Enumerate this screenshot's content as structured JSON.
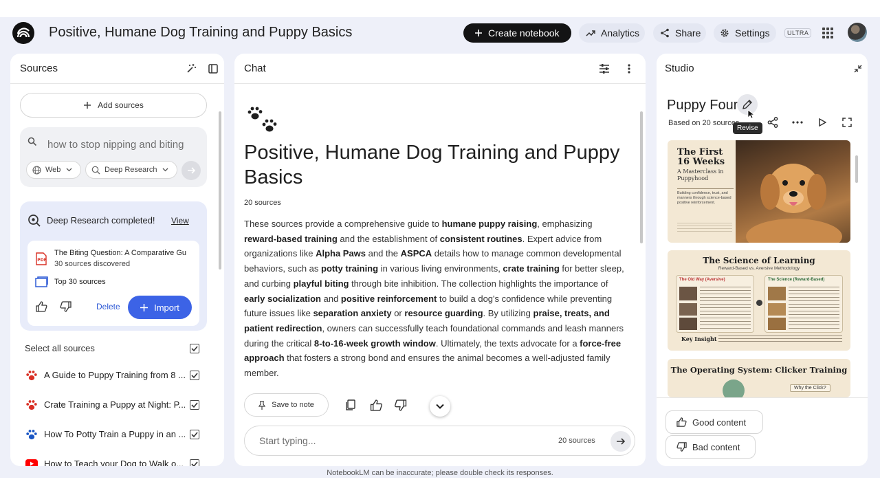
{
  "header": {
    "notebook_title": "Positive, Humane Dog Training and Puppy Basics",
    "create_label": "Create notebook",
    "analytics_label": "Analytics",
    "share_label": "Share",
    "settings_label": "Settings",
    "plan_badge": "ULTRA"
  },
  "sources": {
    "title": "Sources",
    "add_label": "Add sources",
    "search_value": "how to stop nipping and biting",
    "web_chip": "Web",
    "research_chip": "Deep Research",
    "deep_research": {
      "title": "Deep Research completed!",
      "view_label": "View",
      "result_title": "The Biting Question: A Comparative Gu",
      "result_meta": "30 sources discovered",
      "top_label": "Top 30 sources",
      "delete_label": "Delete",
      "import_label": "Import"
    },
    "select_all_label": "Select all sources",
    "items": [
      {
        "label": "A Guide to Puppy Training from 8 ...",
        "icon": "paw-icon",
        "color": "#d93025"
      },
      {
        "label": "Crate Training a Puppy at Night: P...",
        "icon": "paw-icon",
        "color": "#d93025"
      },
      {
        "label": "How To Potty Train a Puppy in an ...",
        "icon": "paw-icon",
        "color": "#1a56c4"
      },
      {
        "label": "How to Teach your Dog to Walk o...",
        "icon": "youtube-icon",
        "color": "#ff0000"
      }
    ]
  },
  "chat": {
    "title": "Chat",
    "heading": "Positive, Humane Dog Training and Puppy Basics",
    "source_count": "20 sources",
    "body": [
      {
        "t": "These sources provide a comprehensive guide to ",
        "b": false
      },
      {
        "t": "humane puppy raising",
        "b": true
      },
      {
        "t": ", emphasizing ",
        "b": false
      },
      {
        "t": "reward-based training",
        "b": true
      },
      {
        "t": " and the establishment of ",
        "b": false
      },
      {
        "t": "consistent routines",
        "b": true
      },
      {
        "t": ". Expert advice from organizations like ",
        "b": false
      },
      {
        "t": "Alpha Paws",
        "b": true
      },
      {
        "t": " and the ",
        "b": false
      },
      {
        "t": "ASPCA",
        "b": true
      },
      {
        "t": " details how to manage common developmental behaviors, such as ",
        "b": false
      },
      {
        "t": "potty training",
        "b": true
      },
      {
        "t": " in various living environments, ",
        "b": false
      },
      {
        "t": "crate training",
        "b": true
      },
      {
        "t": " for better sleep, and curbing ",
        "b": false
      },
      {
        "t": "playful biting",
        "b": true
      },
      {
        "t": " through bite inhibition. The collection highlights the importance of ",
        "b": false
      },
      {
        "t": "early socialization",
        "b": true
      },
      {
        "t": " and ",
        "b": false
      },
      {
        "t": "positive reinforcement",
        "b": true
      },
      {
        "t": " to build a dog's confidence while preventing future issues like ",
        "b": false
      },
      {
        "t": "separation anxiety",
        "b": true
      },
      {
        "t": " or ",
        "b": false
      },
      {
        "t": "resource guarding",
        "b": true
      },
      {
        "t": ". By utilizing ",
        "b": false
      },
      {
        "t": "praise, treats, and patient redirection",
        "b": true
      },
      {
        "t": ", owners can successfully teach foundational commands and leash manners during the critical ",
        "b": false
      },
      {
        "t": "8-to-16-week growth window",
        "b": true
      },
      {
        "t": ". Ultimately, the texts advocate for a ",
        "b": false
      },
      {
        "t": "force-free approach",
        "b": true
      },
      {
        "t": " that fosters a strong bond and ensures the animal becomes a well-adjusted family member.",
        "b": false
      }
    ],
    "save_note_label": "Save to note",
    "input_placeholder": "Start typing...",
    "input_source_count": "20 sources"
  },
  "studio": {
    "title": "Studio",
    "artifact_title": "Puppy Four",
    "artifact_sub": "Based on 20 sources",
    "tooltip": "Revise",
    "slide1": {
      "title": "The First 16 Weeks",
      "subtitle": "A Masterclass in Puppyhood",
      "body": "Building confidence, trust, and manners through science-based positive reinforcement."
    },
    "slide2": {
      "title": "The Science of Learning",
      "subtitle": "Reward-Based vs. Aversive Methodology",
      "left_head": "The Old Way (Aversive)",
      "right_head": "The Science (Reward-Based)",
      "key_label": "Key Insight"
    },
    "slide3": {
      "title": "The Operating System: Clicker Training",
      "note": "Why the Click?"
    },
    "good_label": "Good content",
    "bad_label": "Bad content"
  },
  "footer": {
    "disclaimer": "NotebookLM can be inaccurate; please double check its responses."
  }
}
